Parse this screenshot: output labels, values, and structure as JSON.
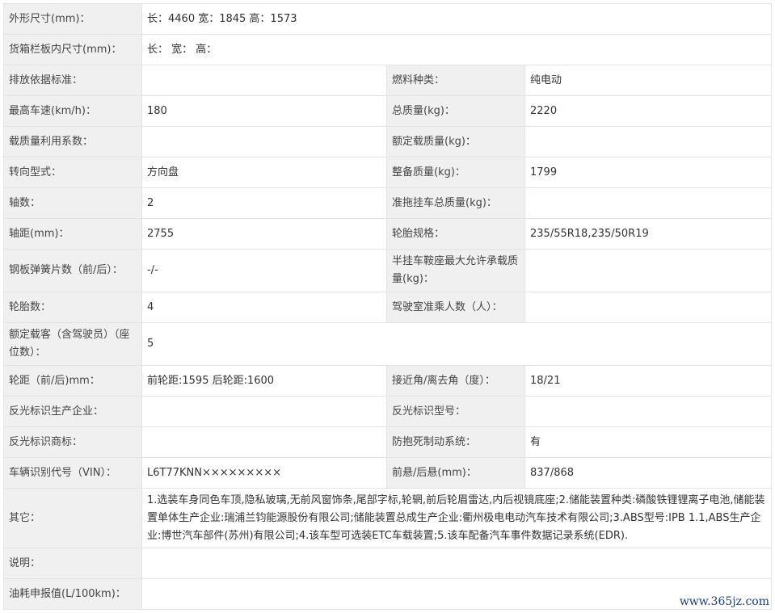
{
  "rows": [
    {
      "type": "wide",
      "label": "外形尺寸(mm)：",
      "value": "长：4460 宽：1845 高：1573"
    },
    {
      "type": "wide",
      "label": "货箱栏板内尺寸(mm)：",
      "value": "长： 宽： 高："
    },
    {
      "type": "pair",
      "label": "排放依据标准：",
      "value": "",
      "label2": "燃料种类：",
      "value2": "纯电动"
    },
    {
      "type": "pair",
      "label": "最高车速(km/h)：",
      "value": "180",
      "label2": "总质量(kg)：",
      "value2": "2220"
    },
    {
      "type": "pair",
      "label": "载质量利用系数：",
      "value": "",
      "label2": "额定载质量(kg)：",
      "value2": ""
    },
    {
      "type": "pair",
      "label": "转向型式：",
      "value": "方向盘",
      "label2": "整备质量(kg)：",
      "value2": "1799"
    },
    {
      "type": "pair",
      "label": "轴数：",
      "value": "2",
      "label2": "准拖挂车总质量(kg)：",
      "value2": ""
    },
    {
      "type": "pair",
      "label": "轴距(mm)：",
      "value": "2755",
      "label2": "轮胎规格：",
      "value2": "235/55R18,235/50R19"
    },
    {
      "type": "pair",
      "label": "钢板弹簧片数（前/后）：",
      "value": "-/-",
      "label2": "半挂车鞍座最大允许承载质量(kg)：",
      "value2": ""
    },
    {
      "type": "pair",
      "label": "轮胎数：",
      "value": "4",
      "label2": "驾驶室准乘人数（人）：",
      "value2": ""
    },
    {
      "type": "wide",
      "label": "额定载客（含驾驶员）（座位数）：",
      "value": "5"
    },
    {
      "type": "pair",
      "label": "轮距（前/后)mm：",
      "value": "前轮距:1595 后轮距:1600",
      "label2": "接近角/离去角（度）：",
      "value2": "18/21"
    },
    {
      "type": "pair",
      "label": "反光标识生产企业：",
      "value": "",
      "label2": "反光标识型号：",
      "value2": ""
    },
    {
      "type": "pair",
      "label": "反光标识商标：",
      "value": "",
      "label2": "防抱死制动系统：",
      "value2": "有"
    },
    {
      "type": "pair",
      "label": "车辆识别代号（VIN）：",
      "value": "L6T77KNN×××××××××",
      "label2": "前悬/后悬(mm)：",
      "value2": "837/868"
    },
    {
      "type": "wide",
      "label": "其它：",
      "value": "1.选装车身同色车顶,隐私玻璃,无前风窗饰条,尾部字标,轮辋,前后轮眉雷达,内后视镜底座;2.储能装置种类:磷酸铁锂锂离子电池,储能装置单体生产企业:瑞浦兰钧能源股份有限公司;储能装置总成生产企业:衢州极电电动汽车技术有限公司;3.ABS型号:IPB 1.1,ABS生产企业:博世汽车部件(苏州)有限公司;4.该车型可选装ETC车载装置;5.该车配备汽车事件数据记录系统(EDR)."
    },
    {
      "type": "wide",
      "label": "说明：",
      "value": ""
    },
    {
      "type": "wide",
      "label": "油耗申报值(L/100km)：",
      "value": ""
    }
  ],
  "watermark": "www.365jz.com"
}
